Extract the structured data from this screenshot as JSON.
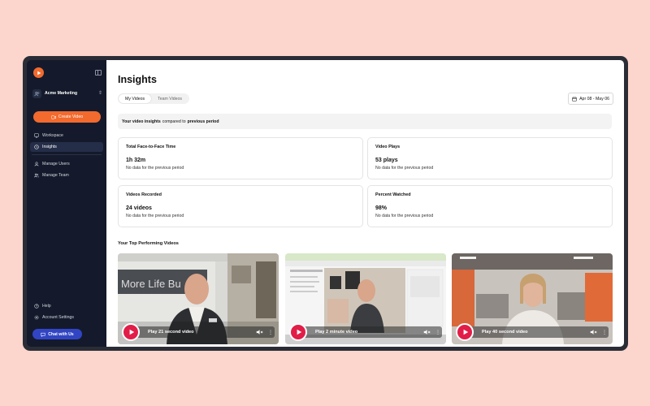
{
  "sidebar": {
    "workspace_name": "Acme Marketing",
    "create_label": "Create Video",
    "nav_top": [
      {
        "label": "Workspace",
        "icon": "monitor-icon",
        "active": false
      },
      {
        "label": "Insights",
        "icon": "clock-icon",
        "active": true
      }
    ],
    "nav_mid": [
      {
        "label": "Manage Users",
        "icon": "user-icon"
      },
      {
        "label": "Manage Team",
        "icon": "users-icon"
      }
    ],
    "nav_bottom": [
      {
        "label": "Help",
        "icon": "help-icon"
      },
      {
        "label": "Account Settings",
        "icon": "gear-icon"
      }
    ],
    "chat_label": "Chat with Us"
  },
  "header": {
    "title": "Insights",
    "tabs": [
      {
        "label": "My Videos",
        "active": true
      },
      {
        "label": "Team Videos",
        "active": false
      }
    ],
    "date_range": "Apr 08 - May 06"
  },
  "info": {
    "bold": "Your video insights",
    "rest": "compared to",
    "period": "previous period"
  },
  "cards": [
    {
      "title": "Total Face-to-Face Time",
      "value": "1h 32m",
      "sub": "No data for the previous period"
    },
    {
      "title": "Video Plays",
      "value": "53 plays",
      "sub": "No data for the previous period"
    },
    {
      "title": "Videos Recorded",
      "value": "24 videos",
      "sub": "No data for the previous period"
    },
    {
      "title": "Percent Watched",
      "value": "98%",
      "sub": "No data for the previous period"
    }
  ],
  "top_videos": {
    "title": "Your Top Performing Videos",
    "items": [
      {
        "label": "Play 21 second video"
      },
      {
        "label": "Play 2 minute video"
      },
      {
        "label": "Play 40 second video"
      }
    ]
  },
  "colors": {
    "brand": "#f26a2e",
    "chat": "#3145c4",
    "play": "#e11d48",
    "sidebar": "#141a2b"
  }
}
